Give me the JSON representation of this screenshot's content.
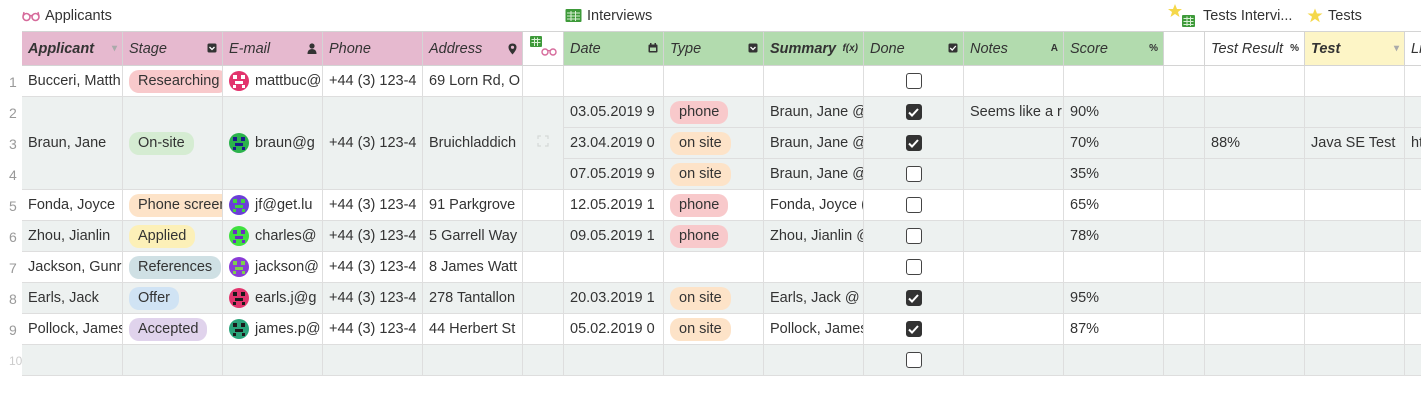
{
  "groups": [
    {
      "id": "applicants",
      "label": "Applicants",
      "icon": "glasses-icon"
    },
    {
      "id": "interviews",
      "label": "Interviews",
      "icon": "spreadsheet-icon"
    },
    {
      "id": "tests-interviews",
      "label": "Tests Intervi...",
      "icon": "star-spreadsheet-icon"
    },
    {
      "id": "tests",
      "label": "Tests",
      "icon": "star-icon"
    }
  ],
  "columns": {
    "applicant": "Applicant",
    "stage": "Stage",
    "email": "E-mail",
    "phone": "Phone",
    "address": "Address",
    "date": "Date",
    "type": "Type",
    "summary": "Summary",
    "done": "Done",
    "notes": "Notes",
    "score": "Score",
    "test_result": "Test Result",
    "test": "Test",
    "link": "Li"
  },
  "colors": {
    "applicants_header": "#e6b9cf",
    "interviews_header": "#b2dbae",
    "test_header": "#fdf5c6",
    "row_shade": "#edf1f0",
    "chip_researching": "#f8c9cb",
    "chip_onsite": "#d5ecd2",
    "chip_phonescreen": "#fde3c8",
    "chip_applied": "#fcf0b8",
    "chip_references": "#cfe0e4",
    "chip_offer": "#d0e3f4",
    "chip_accepted": "#e0d3ec",
    "chip_phone": "#f8c9cb",
    "chip_onsite_type": "#fde3c8"
  },
  "applicants": [
    {
      "num": "1",
      "name": "Bucceri, Matth",
      "stage": "Researching",
      "email": "mattbuc@",
      "phone": "+44 (3) 123-4",
      "address": "69 Lorn Rd, O"
    },
    {
      "num": "2-4",
      "name": "Braun, Jane",
      "stage": "On-site",
      "email": "braun@g",
      "phone": "+44 (3) 123-4",
      "address": "Bruichladdich"
    },
    {
      "num": "5",
      "name": "Fonda, Joyce",
      "stage": "Phone screen",
      "email": "jf@get.lu",
      "phone": "+44 (3) 123-4",
      "address": "91 Parkgrove"
    },
    {
      "num": "6",
      "name": "Zhou, Jianlin",
      "stage": "Applied",
      "email": "charles@",
      "phone": "+44 (3) 123-4",
      "address": "5 Garrell Way"
    },
    {
      "num": "7",
      "name": "Jackson, Gunr",
      "stage": "References",
      "email": "jackson@",
      "phone": "+44 (3) 123-4",
      "address": "8 James Watt"
    },
    {
      "num": "8",
      "name": "Earls, Jack",
      "stage": "Offer",
      "email": "earls.j@g",
      "phone": "+44 (3) 123-4",
      "address": "278 Tantallon"
    },
    {
      "num": "9",
      "name": "Pollock, James",
      "stage": "Accepted",
      "email": "james.p@",
      "phone": "+44 (3) 123-4",
      "address": "44 Herbert St"
    }
  ],
  "row_numbers": [
    "1",
    "2",
    "3",
    "4",
    "5",
    "6",
    "7",
    "8",
    "9",
    "10"
  ],
  "interviews": [
    {
      "date": "",
      "type": "",
      "summary": "",
      "done": false,
      "notes": "",
      "score": ""
    },
    {
      "date": "03.05.2019 9",
      "type": "phone",
      "summary": "Braun, Jane @",
      "done": true,
      "notes": "Seems like a r",
      "score": "90%"
    },
    {
      "date": "23.04.2019 0",
      "type": "on site",
      "summary": "Braun, Jane @",
      "done": true,
      "notes": "",
      "score": "70%",
      "test_result": "88%",
      "test": "Java SE Test",
      "link": "ht"
    },
    {
      "date": "07.05.2019 9",
      "type": "on site",
      "summary": "Braun, Jane @",
      "done": false,
      "notes": "",
      "score": "35%"
    },
    {
      "date": "12.05.2019 1",
      "type": "phone",
      "summary": "Fonda, Joyce (",
      "done": false,
      "notes": "",
      "score": "65%"
    },
    {
      "date": "09.05.2019 1",
      "type": "phone",
      "summary": "Zhou, Jianlin @",
      "done": false,
      "notes": "",
      "score": "78%"
    },
    {
      "date": "",
      "type": "",
      "summary": "",
      "done": false,
      "notes": "",
      "score": ""
    },
    {
      "date": "20.03.2019 1",
      "type": "on site",
      "summary": "Earls, Jack @ S",
      "done": true,
      "notes": "",
      "score": "95%"
    },
    {
      "date": "05.02.2019 0",
      "type": "on site",
      "summary": "Pollock, James",
      "done": true,
      "notes": "",
      "score": "87%"
    },
    {
      "date": "",
      "type": "",
      "summary": "",
      "done": false,
      "notes": "",
      "score": ""
    }
  ]
}
